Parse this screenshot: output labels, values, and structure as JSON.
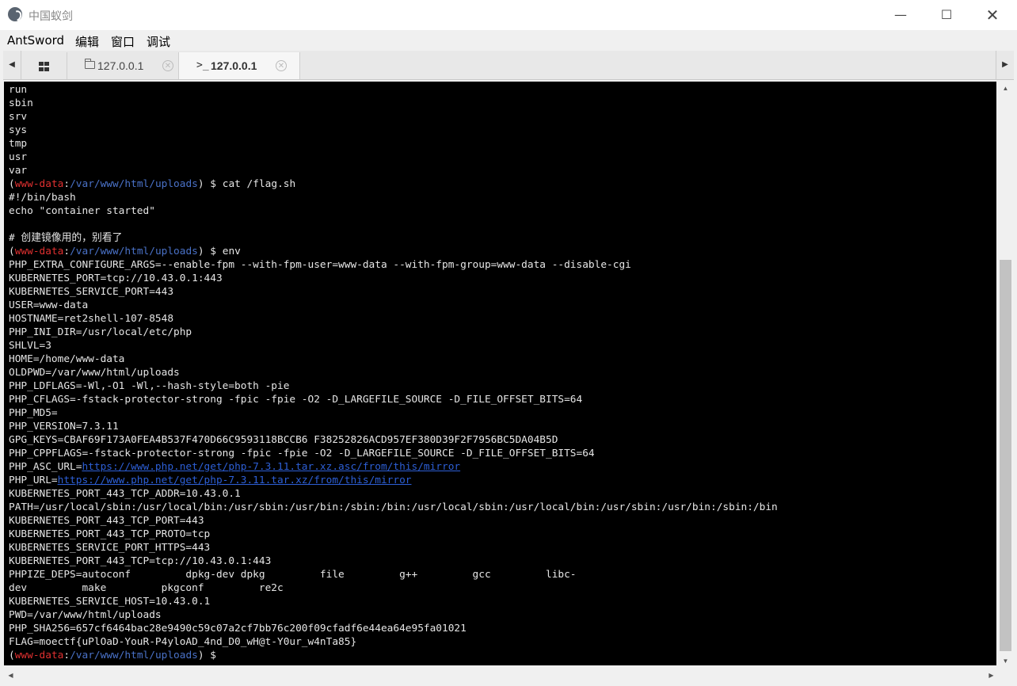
{
  "window": {
    "title": "中国蚁剑",
    "controls": {
      "minimize": "—",
      "maximize": "☐",
      "close": "✕"
    }
  },
  "menu": [
    {
      "label": "AntSword"
    },
    {
      "label": "编辑"
    },
    {
      "label": "窗口"
    },
    {
      "label": "调试"
    }
  ],
  "tabs": {
    "scroll_left": "◀",
    "scroll_right": "▶",
    "home": {
      "icon": "grid-icon"
    },
    "files": {
      "label": "127.0.0.1",
      "icon": "folder-icon",
      "close": "✕"
    },
    "terminal": {
      "label": "127.0.0.1",
      "icon": ">_",
      "close": "✕",
      "active": true
    }
  },
  "prompt": {
    "user": "www-data",
    "path": "/var/www/html/uploads",
    "symbol": "$"
  },
  "terminal": {
    "lines": [
      {
        "t": "text",
        "v": "run"
      },
      {
        "t": "text",
        "v": "sbin"
      },
      {
        "t": "text",
        "v": "srv"
      },
      {
        "t": "text",
        "v": "sys"
      },
      {
        "t": "text",
        "v": "tmp"
      },
      {
        "t": "text",
        "v": "usr"
      },
      {
        "t": "text",
        "v": "var"
      },
      {
        "t": "prompt",
        "cmd": "cat /flag.sh"
      },
      {
        "t": "text",
        "v": "#!/bin/bash"
      },
      {
        "t": "text",
        "v": "echo \"container started\""
      },
      {
        "t": "text",
        "v": ""
      },
      {
        "t": "text",
        "v": "# 创建镜像用的，别看了"
      },
      {
        "t": "prompt",
        "cmd": "env"
      },
      {
        "t": "text",
        "v": "PHP_EXTRA_CONFIGURE_ARGS=--enable-fpm --with-fpm-user=www-data --with-fpm-group=www-data --disable-cgi"
      },
      {
        "t": "text",
        "v": "KUBERNETES_PORT=tcp://10.43.0.1:443"
      },
      {
        "t": "text",
        "v": "KUBERNETES_SERVICE_PORT=443"
      },
      {
        "t": "text",
        "v": "USER=www-data"
      },
      {
        "t": "text",
        "v": "HOSTNAME=ret2shell-107-8548"
      },
      {
        "t": "text",
        "v": "PHP_INI_DIR=/usr/local/etc/php"
      },
      {
        "t": "text",
        "v": "SHLVL=3"
      },
      {
        "t": "text",
        "v": "HOME=/home/www-data"
      },
      {
        "t": "text",
        "v": "OLDPWD=/var/www/html/uploads"
      },
      {
        "t": "text",
        "v": "PHP_LDFLAGS=-Wl,-O1 -Wl,--hash-style=both -pie"
      },
      {
        "t": "text",
        "v": "PHP_CFLAGS=-fstack-protector-strong -fpic -fpie -O2 -D_LARGEFILE_SOURCE -D_FILE_OFFSET_BITS=64"
      },
      {
        "t": "text",
        "v": "PHP_MD5="
      },
      {
        "t": "text",
        "v": "PHP_VERSION=7.3.11"
      },
      {
        "t": "text",
        "v": "GPG_KEYS=CBAF69F173A0FEA4B537F470D66C9593118BCCB6 F38252826ACD957EF380D39F2F7956BC5DA04B5D"
      },
      {
        "t": "text",
        "v": "PHP_CPPFLAGS=-fstack-protector-strong -fpic -fpie -O2 -D_LARGEFILE_SOURCE -D_FILE_OFFSET_BITS=64"
      },
      {
        "t": "link",
        "k": "PHP_ASC_URL=",
        "v": "https://www.php.net/get/php-7.3.11.tar.xz.asc/from/this/mirror"
      },
      {
        "t": "link",
        "k": "PHP_URL=",
        "v": "https://www.php.net/get/php-7.3.11.tar.xz/from/this/mirror"
      },
      {
        "t": "text",
        "v": "KUBERNETES_PORT_443_TCP_ADDR=10.43.0.1"
      },
      {
        "t": "text",
        "v": "PATH=/usr/local/sbin:/usr/local/bin:/usr/sbin:/usr/bin:/sbin:/bin:/usr/local/sbin:/usr/local/bin:/usr/sbin:/usr/bin:/sbin:/bin"
      },
      {
        "t": "text",
        "v": "KUBERNETES_PORT_443_TCP_PORT=443"
      },
      {
        "t": "text",
        "v": "KUBERNETES_PORT_443_TCP_PROTO=tcp"
      },
      {
        "t": "text",
        "v": "KUBERNETES_SERVICE_PORT_HTTPS=443"
      },
      {
        "t": "text",
        "v": "KUBERNETES_PORT_443_TCP=tcp://10.43.0.1:443"
      },
      {
        "t": "text",
        "v": "PHPIZE_DEPS=autoconf         dpkg-dev dpkg         file         g++         gcc         libc-"
      },
      {
        "t": "text",
        "v": "dev         make         pkgconf         re2c"
      },
      {
        "t": "text",
        "v": "KUBERNETES_SERVICE_HOST=10.43.0.1"
      },
      {
        "t": "text",
        "v": "PWD=/var/www/html/uploads"
      },
      {
        "t": "text",
        "v": "PHP_SHA256=657cf6464bac28e9490c59c07a2cf7bb76c200f09cfadf6e44ea64e95fa01021"
      },
      {
        "t": "text",
        "v": "FLAG=moectf{uPlOaD-YouR-P4yloAD_4nd_D0_wH@t-Y0ur_w4nTa85}"
      },
      {
        "t": "prompt",
        "cmd": ""
      }
    ]
  },
  "scrollbars": {
    "up": "▲",
    "down": "▼",
    "left": "◀",
    "right": "▶"
  }
}
